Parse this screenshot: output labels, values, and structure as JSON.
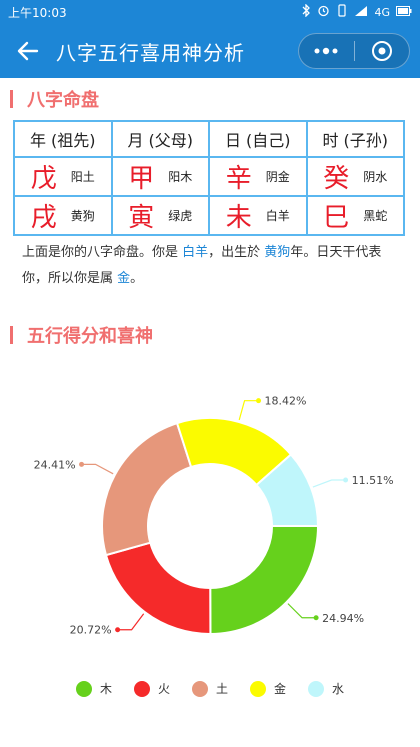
{
  "status_bar": {
    "time": "上午10:03",
    "network": "4G"
  },
  "nav": {
    "title": "八字五行喜用神分析"
  },
  "section1": {
    "title": "八字命盘"
  },
  "table": {
    "headers": [
      "年 (祖先)",
      "月 (父母)",
      "日 (自己)",
      "时 (子孙)"
    ],
    "rows": [
      [
        {
          "big": "戊",
          "small": "阳土"
        },
        {
          "big": "甲",
          "small": "阳木"
        },
        {
          "big": "辛",
          "small": "阴金"
        },
        {
          "big": "癸",
          "small": "阴水"
        }
      ],
      [
        {
          "big": "戌",
          "small": "黄狗"
        },
        {
          "big": "寅",
          "small": "绿虎"
        },
        {
          "big": "未",
          "small": "白羊"
        },
        {
          "big": "巳",
          "small": "黑蛇"
        }
      ]
    ]
  },
  "description": {
    "p1": "上面是你的八字命盘。你是 ",
    "hl1": "白羊",
    "p2": "，出生於 ",
    "hl2": "黄狗",
    "p3": "年。日天干代表你，所以你是属 ",
    "hl3": "金",
    "p4": "。"
  },
  "section2": {
    "title": "五行得分和喜神"
  },
  "chart_data": {
    "type": "pie",
    "categories": [
      "木",
      "火",
      "土",
      "金",
      "水"
    ],
    "values": [
      24.94,
      20.72,
      24.41,
      18.42,
      11.51
    ],
    "labels": [
      "24.94%",
      "20.72%",
      "24.41%",
      "18.42%",
      "11.51%"
    ],
    "colors": [
      "#66d11c",
      "#f52a2a",
      "#e6977b",
      "#fbfb00",
      "#bff6fb"
    ],
    "legend_position": "bottom"
  }
}
